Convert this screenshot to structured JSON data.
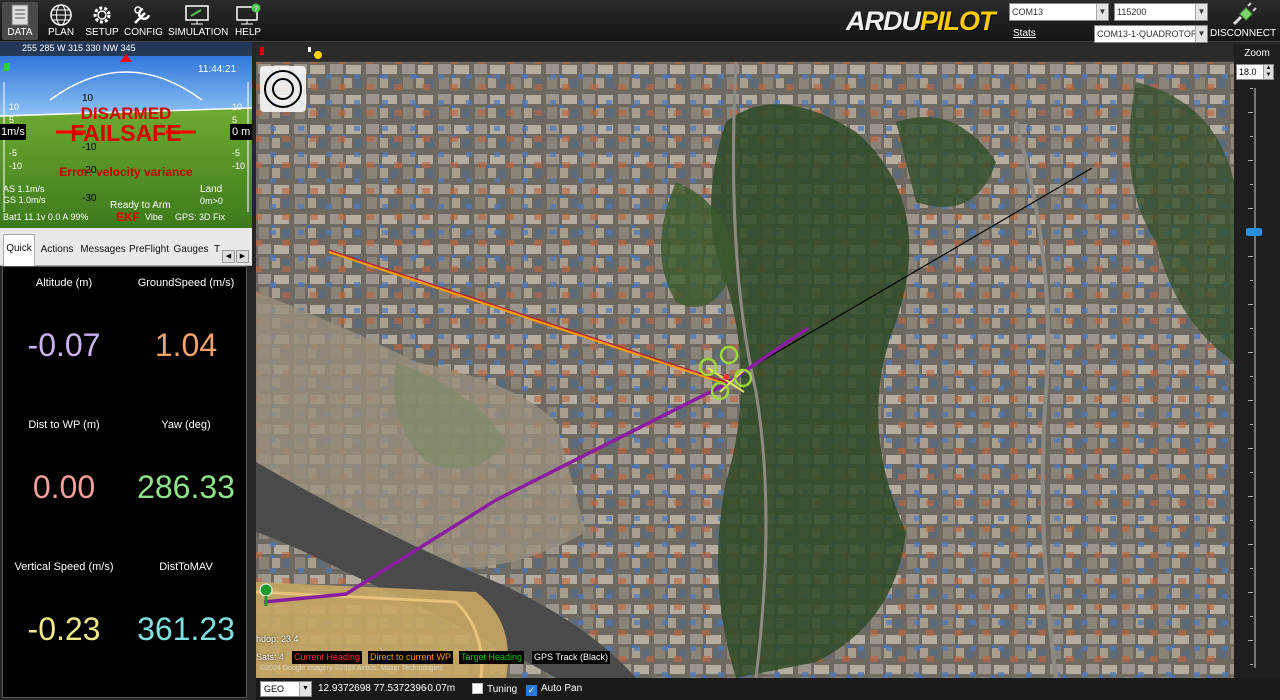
{
  "menu": [
    {
      "label": "DATA",
      "icon": "data-icon"
    },
    {
      "label": "PLAN",
      "icon": "globe-icon"
    },
    {
      "label": "SETUP",
      "icon": "gear-icon"
    },
    {
      "label": "CONFIG",
      "icon": "wrench-icon"
    },
    {
      "label": "SIMULATION",
      "icon": "monitor-icon"
    },
    {
      "label": "HELP",
      "icon": "help-monitor-icon"
    }
  ],
  "logo": {
    "part1": "ARDU",
    "part2": "PILOT"
  },
  "connection": {
    "port": "COM13",
    "baud": "115200",
    "vehicle": "COM13-1-QUADROTOR",
    "stats_label": "Stats",
    "disconnect_label": "DISCONNECT"
  },
  "hud": {
    "status": "DISARMED",
    "failsafe": "FAILSAFE",
    "error": "Error: velocity variance",
    "ready": "Ready to Arm",
    "mode": "Land",
    "climb": "0m>0",
    "airspeed": "AS 1.1m/s",
    "groundspeed": "GS 1.0m/s",
    "battery": "Bat1 11.1v 0.0 A 99%",
    "ekf": "EKF",
    "vibe": "Vibe",
    "gps": "GPS: 3D Fix",
    "time": "11:44:21",
    "speed_box": "1m/s",
    "alt_box": "0 m",
    "heading_scale": "255  285  W  315  330  NW  345",
    "pitch_labels": [
      "10",
      "-10",
      "-20",
      "-30"
    ],
    "left_scale": [
      "10",
      "5",
      "0",
      "-5",
      "-10"
    ],
    "right_scale": [
      "10",
      "5",
      "0",
      "-5",
      "-10"
    ]
  },
  "tabs": [
    {
      "label": "Quick",
      "active": true
    },
    {
      "label": "Actions"
    },
    {
      "label": "Messages"
    },
    {
      "label": "PreFlight"
    },
    {
      "label": "Gauges"
    },
    {
      "label": "T"
    }
  ],
  "quick": [
    {
      "label": "Altitude (m)",
      "value": "-0.07",
      "color": "#c9b3f0"
    },
    {
      "label": "GroundSpeed (m/s)",
      "value": "1.04",
      "color": "#f4a36b"
    },
    {
      "label": "Dist to WP (m)",
      "value": "0.00",
      "color": "#f4a09a"
    },
    {
      "label": "Yaw (deg)",
      "value": "286.33",
      "color": "#8fe38a"
    },
    {
      "label": "Vertical Speed (m/s)",
      "value": "-0.23",
      "color": "#f2ea8a"
    },
    {
      "label": "DistToMAV",
      "value": "361.23",
      "color": "#7fe0e0"
    }
  ],
  "map": {
    "hdop": "hdop: 23.4",
    "sats": "Sats: 4",
    "legend": [
      {
        "label": "Current Heading",
        "color": "#ff3030"
      },
      {
        "label": "Direct to current WP",
        "color": "#ff9a00"
      },
      {
        "label": "Target Heading",
        "color": "#22c322"
      },
      {
        "label": "GPS Track (Black)",
        "color": "#ffffff"
      }
    ],
    "copyright": "©2024 Google  Imagery ©2024 Airbus, Maxar Technologies"
  },
  "zoom": {
    "label": "Zoom",
    "value": "18.0"
  },
  "statusbar": {
    "coord_type": "GEO",
    "coords": "12.9372698 77.5372396",
    "alt": "-0.07m",
    "tuning_label": "Tuning",
    "autopan_label": "Auto Pan"
  }
}
